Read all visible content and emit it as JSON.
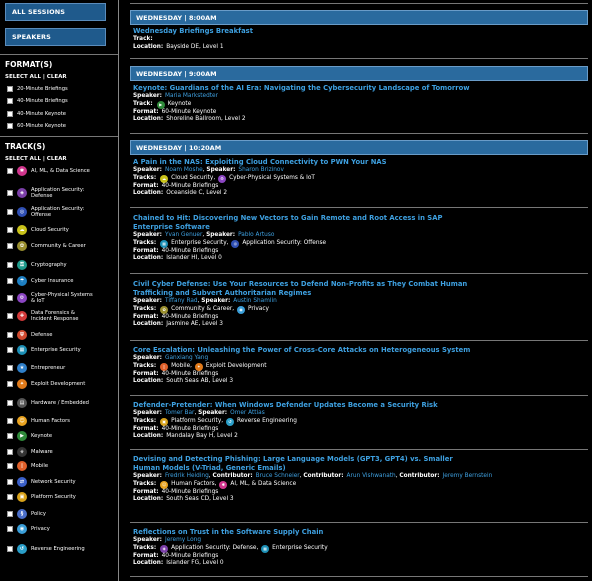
{
  "nav": {
    "all_sessions": "ALL SESSIONS",
    "speakers": "SPEAKERS"
  },
  "format_filter": {
    "heading": "FORMAT(S)",
    "select_clear": "SELECT ALL | CLEAR",
    "options": [
      "20-Minute Briefings",
      "40-Minute Briefings",
      "40-Minute Keynote",
      "60-Minute Keynote"
    ]
  },
  "track_filter": {
    "heading": "TRACK(S)",
    "select_clear": "SELECT ALL | CLEAR",
    "tracks": [
      {
        "label": "AI, ML, & Data Science",
        "icon": "ai-ml-icon",
        "color": "#d0358c"
      },
      {
        "label": "Application Security: Defense",
        "icon": "appsec-defense-icon",
        "color": "#7b3fa8"
      },
      {
        "label": "Application Security: Offense",
        "icon": "appsec-offense-icon",
        "color": "#2f4fb3"
      },
      {
        "label": "Cloud Security",
        "icon": "cloud-icon",
        "color": "#c9c21a"
      },
      {
        "label": "Community & Career",
        "icon": "community-icon",
        "color": "#9a8f2f"
      },
      {
        "label": "Cryptography",
        "icon": "crypto-icon",
        "color": "#1f9b8c"
      },
      {
        "label": "Cyber Insurance",
        "icon": "insurance-icon",
        "color": "#1d7fc2"
      },
      {
        "label": "Cyber-Physical Systems & IoT",
        "icon": "iot-icon",
        "color": "#8b45c2"
      },
      {
        "label": "Data Forensics & Incident Response",
        "icon": "forensics-icon",
        "color": "#d33a3a"
      },
      {
        "label": "Defense",
        "icon": "defense-icon",
        "color": "#d04a2f"
      },
      {
        "label": "Enterprise Security",
        "icon": "enterprise-icon",
        "color": "#1c8fb5"
      },
      {
        "label": "Entrepreneur",
        "icon": "entrepreneur-icon",
        "color": "#2f7fc8"
      },
      {
        "label": "Exploit Development",
        "icon": "exploit-icon",
        "color": "#e07a1a"
      },
      {
        "label": "Hardware / Embedded",
        "icon": "hardware-icon",
        "color": "#555555"
      },
      {
        "label": "Human Factors",
        "icon": "human-factors-icon",
        "color": "#e8a21f"
      },
      {
        "label": "Keynote",
        "icon": "keynote-icon",
        "color": "#2f8a3a"
      },
      {
        "label": "Malware",
        "icon": "malware-icon",
        "color": "#333333"
      },
      {
        "label": "Mobile",
        "icon": "mobile-icon",
        "color": "#e0602a"
      },
      {
        "label": "Network Security",
        "icon": "network-icon",
        "color": "#3a5fc8"
      },
      {
        "label": "Platform Security",
        "icon": "platform-icon",
        "color": "#d8a21a"
      },
      {
        "label": "Policy",
        "icon": "policy-icon",
        "color": "#4a6ec8"
      },
      {
        "label": "Privacy",
        "icon": "privacy-icon",
        "color": "#3a9ed8"
      },
      {
        "label": "Reverse Engineering",
        "icon": "reverse-icon",
        "color": "#2a9ec8"
      }
    ]
  },
  "labels": {
    "speaker": "Speaker:",
    "track": "Track:",
    "tracks": "Tracks:",
    "format": "Format:",
    "location": "Location:",
    "contributor": "Contributor:"
  },
  "schedule": [
    {
      "time": "WEDNESDAY | 8:00AM",
      "sessions": [
        {
          "title": "Wednesday Briefings Breakfast",
          "track_text": "",
          "location": "Bayside DE, Level 1"
        }
      ]
    },
    {
      "time": "WEDNESDAY | 9:00AM",
      "sessions": [
        {
          "title": "Keynote: Guardians of the AI Era: Navigating the Cybersecurity Landscape of Tomorrow",
          "speakers": "Maria Markstedter",
          "track": "Keynote",
          "format": "60-Minute Keynote",
          "location": "Shoreline Ballroom, Level 2"
        }
      ]
    },
    {
      "time": "WEDNESDAY | 10:20AM",
      "sessions": [
        {
          "title": "A Pain in the NAS: Exploiting Cloud Connectivity to PWN Your NAS",
          "speaker1": "Noam Moshe",
          "speaker2": "Sharon Brizinov",
          "tracks": [
            "Cloud Security",
            "Cyber-Physical Systems & IoT"
          ],
          "format": "40-Minute Briefings",
          "location": "Oceanside C, Level 2"
        },
        {
          "title": "Chained to Hit: Discovering New Vectors to Gain Remote and Root Access in SAP Enterprise Software",
          "speaker1": "Yvan Genuer",
          "speaker2": "Pablo Artuso",
          "tracks": [
            "Enterprise Security",
            "Application Security: Offense"
          ],
          "format": "40-Minute Briefings",
          "location": "Islander HI, Level 0"
        },
        {
          "title": "Civil Cyber Defense: Use Your Resources to Defend Non-Profits as They Combat Human Trafficking and Subvert Authoritarian Regimes",
          "speaker1": "Tiffany Rad",
          "speaker2": "Austin Shamlin",
          "tracks": [
            "Community & Career",
            "Privacy"
          ],
          "format": "40-Minute Briefings",
          "location": "Jasmine AE, Level 3"
        },
        {
          "title": "Core Escalation: Unleashing the Power of Cross-Core Attacks on Heterogeneous System",
          "speaker1": "Ganxiang Yang",
          "tracks": [
            "Mobile",
            "Exploit Development"
          ],
          "format": "40-Minute Briefings",
          "location": "South Seas AB, Level 3"
        },
        {
          "title": "Defender-Pretender: When Windows Defender Updates Become a Security Risk",
          "speaker1": "Tomer Bar",
          "speaker2": "Omer Attias",
          "tracks": [
            "Platform Security",
            "Reverse Engineering"
          ],
          "format": "40-Minute Briefings",
          "location": "Mandalay Bay H, Level 2"
        },
        {
          "title": "Devising and Detecting Phishing: Large Language Models (GPT3, GPT4) vs. Smaller Human Models (V-Triad, Generic Emails)",
          "speaker1": "Fredrik Heiding",
          "contributor1": "Bruce Schneier",
          "contributor2": "Arun Vishwanath",
          "contributor3": "Jeremy Bernstein",
          "tracks": [
            "Human Factors",
            "AI, ML, & Data Science"
          ],
          "format": "40-Minute Briefings",
          "location": "South Seas CD, Level 3"
        },
        {
          "title": "Reflections on Trust in the Software Supply Chain",
          "speaker1": "Jeremy Long",
          "tracks": [
            "Application Security: Defense",
            "Enterprise Security"
          ],
          "format": "40-Minute Briefings",
          "location": "Islander FG, Level 0"
        }
      ]
    }
  ]
}
